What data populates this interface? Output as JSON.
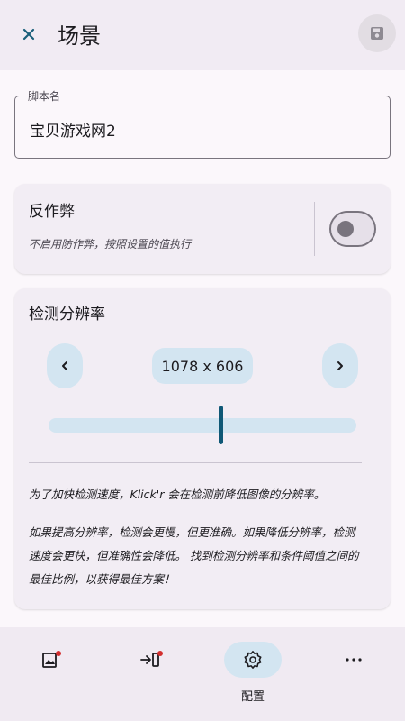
{
  "header": {
    "title": "场景",
    "close_icon": "close-icon",
    "save_icon": "save-icon"
  },
  "script_name": {
    "label": "脚本名",
    "value": "宝贝游戏网2"
  },
  "anti_cheat": {
    "title": "反作弊",
    "subtitle": "不启用防作弊，按照设置的值执行",
    "enabled": false
  },
  "resolution": {
    "title": "检测分辨率",
    "value": "1078 x 606",
    "prev_icon": "chevron-left-icon",
    "next_icon": "chevron-right-icon",
    "slider_fraction": 0.56,
    "description_1": "为了加快检测速度，Klick'r 会在检测前降低图像的分辨率。",
    "description_2_lines": [
      "如果提高分辨率，检测会更慢，但更准确。如果降低分辨率，检测",
      "速度会更快，但准确性会降低。 找到检测分辨率和条件阈值之间的",
      "最佳比例，以获得最佳方案！"
    ]
  },
  "bottom_nav": {
    "items": [
      {
        "icon": "image-condition-icon",
        "label": ""
      },
      {
        "icon": "action-enter-icon",
        "label": ""
      },
      {
        "icon": "gear-icon",
        "label": "配置"
      },
      {
        "icon": "more-icon",
        "label": ""
      }
    ]
  },
  "colors": {
    "accent": "#1a5f7a",
    "chip": "#d3e5f1",
    "card": "#f2edf4",
    "badge": "#d32f2f"
  }
}
